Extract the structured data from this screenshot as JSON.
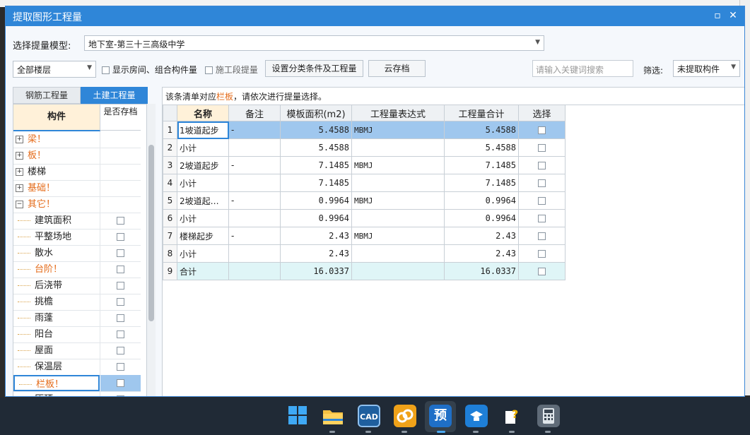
{
  "window": {
    "title": "提取图形工程量"
  },
  "toolbar": {
    "model_label": "选择提量模型:",
    "model_value": "地下室-第三十三高级中学",
    "floor_value": "全部楼层",
    "show_rooms_label": "显示房间、组合构件量",
    "construction_section_label": "施工段提量",
    "set_conditions_button": "设置分类条件及工程量",
    "cloud_save_button": "云存档",
    "search_placeholder": "请输入关键词搜索",
    "filter_label": "筛选:",
    "filter_value": "未提取构件"
  },
  "tabs": [
    {
      "label": "钢筋工程量",
      "active": false
    },
    {
      "label": "土建工程量",
      "active": true
    }
  ],
  "component_table": {
    "headers": [
      "构件",
      "是否存档"
    ],
    "rows": [
      {
        "label": "梁！",
        "type": "group",
        "expanded": false,
        "orange": true
      },
      {
        "label": "板！",
        "type": "group",
        "expanded": false,
        "orange": true
      },
      {
        "label": "楼梯",
        "type": "group",
        "expanded": false,
        "orange": false
      },
      {
        "label": "基础！",
        "type": "group",
        "expanded": false,
        "orange": true
      },
      {
        "label": "其它！",
        "type": "group",
        "expanded": true,
        "orange": true
      },
      {
        "label": "建筑面积",
        "type": "child",
        "orange": false
      },
      {
        "label": "平整场地",
        "type": "child",
        "orange": false
      },
      {
        "label": "散水",
        "type": "child",
        "orange": false
      },
      {
        "label": "台阶！",
        "type": "child",
        "orange": true
      },
      {
        "label": "后浇带",
        "type": "child",
        "orange": false
      },
      {
        "label": "挑檐",
        "type": "child",
        "orange": false
      },
      {
        "label": "雨蓬",
        "type": "child",
        "orange": false
      },
      {
        "label": "阳台",
        "type": "child",
        "orange": false
      },
      {
        "label": "屋面",
        "type": "child",
        "orange": false
      },
      {
        "label": "保温层",
        "type": "child",
        "orange": false
      },
      {
        "label": "栏板！",
        "type": "child",
        "orange": true,
        "selected": true
      },
      {
        "label": "压顶",
        "type": "child",
        "orange": false
      }
    ]
  },
  "hint": {
    "prefix": "该条清单对应",
    "highlight": "栏板",
    "suffix": "，请依次进行提量选择。"
  },
  "quantity_table": {
    "headers": [
      "名称",
      "备注",
      "模板面积(m2)",
      "工程量表达式",
      "工程量合计",
      "选择"
    ],
    "rows": [
      {
        "idx": "1",
        "name": "1坡道起步",
        "note": "-",
        "area": "5.4588",
        "expr": "MBMJ",
        "total": "5.4588",
        "selected": true
      },
      {
        "idx": "2",
        "name": "小计",
        "note": "",
        "area": "5.4588",
        "expr": "",
        "total": "5.4588"
      },
      {
        "idx": "3",
        "name": "2坡道起步",
        "note": "-",
        "area": "7.1485",
        "expr": "MBMJ",
        "total": "7.1485"
      },
      {
        "idx": "4",
        "name": "小计",
        "note": "",
        "area": "7.1485",
        "expr": "",
        "total": "7.1485"
      },
      {
        "idx": "5",
        "name": "2坡道起…",
        "note": "-",
        "area": "0.9964",
        "expr": "MBMJ",
        "total": "0.9964"
      },
      {
        "idx": "6",
        "name": "小计",
        "note": "",
        "area": "0.9964",
        "expr": "",
        "total": "0.9964"
      },
      {
        "idx": "7",
        "name": "楼梯起步",
        "note": "-",
        "area": "2.43",
        "expr": "MBMJ",
        "total": "2.43"
      },
      {
        "idx": "8",
        "name": "小计",
        "note": "",
        "area": "2.43",
        "expr": "",
        "total": "2.43"
      },
      {
        "idx": "9",
        "name": "合计",
        "note": "",
        "area": "16.0337",
        "expr": "",
        "total": "16.0337",
        "is_total": true
      }
    ]
  },
  "taskbar": {
    "icons": [
      "windows-start-icon",
      "file-explorer-icon",
      "cad-app-icon",
      "link-app-icon",
      "budget-app-icon",
      "glodon-app-icon",
      "help-app-icon",
      "calculator-icon"
    ],
    "labels": {
      "cad": "CAD",
      "budget": "预"
    }
  }
}
